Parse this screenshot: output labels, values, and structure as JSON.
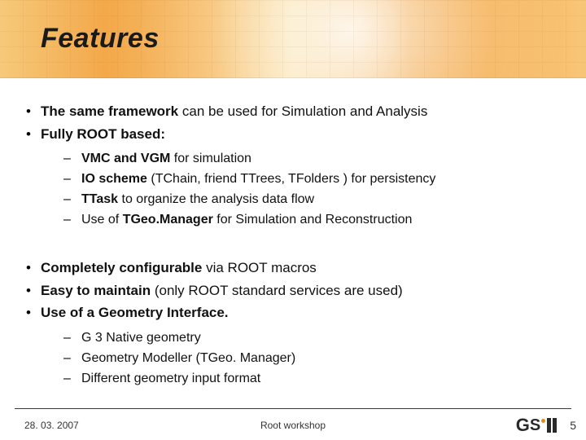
{
  "title": "Features",
  "bullets1": [
    {
      "strong": "The same framework",
      "rest": " can be used for Simulation and Analysis"
    },
    {
      "strong": "Fully ROOT based:",
      "rest": ""
    }
  ],
  "sub1": [
    {
      "strong": "VMC and VGM",
      "rest": " for simulation"
    },
    {
      "strong": "IO scheme",
      "rest": " (TChain, friend TTrees, TFolders ) for persistency"
    },
    {
      "strong": "TTask",
      "rest": " to organize the analysis data flow"
    },
    {
      "prefix": "Use of ",
      "strong": "TGeo.Manager",
      "rest": " for Simulation and Reconstruction"
    }
  ],
  "bullets2": [
    {
      "strong": "Completely configurable",
      "rest": " via ROOT macros"
    },
    {
      "strong": "Easy to maintain",
      "rest": " (only ROOT standard services are used)"
    },
    {
      "strong": "Use of a Geometry Interface.",
      "rest": ""
    }
  ],
  "sub2": [
    "G 3 Native geometry",
    "Geometry Modeller (TGeo. Manager)",
    "Different geometry input format"
  ],
  "footer": {
    "date": "28. 03. 2007",
    "center": "Root workshop",
    "page": "5",
    "logo": {
      "g": "G",
      "s": "S"
    }
  }
}
